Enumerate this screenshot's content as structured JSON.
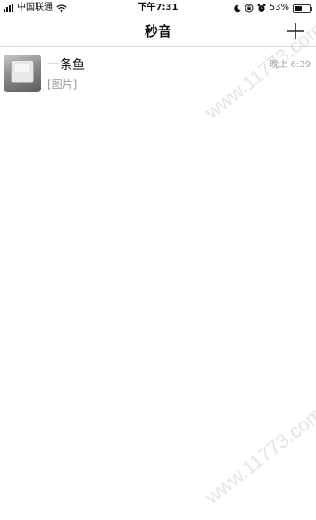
{
  "status_bar": {
    "carrier": "中国联通",
    "time": "下午7:31",
    "battery_percent": "53%",
    "battery_level": 0.53,
    "icons": [
      "signal-icon",
      "wifi-icon",
      "moon-icon",
      "lock-rotation-icon",
      "alarm-icon",
      "battery-icon"
    ]
  },
  "nav": {
    "title": "秒音",
    "add_icon": "plus-icon"
  },
  "chats": [
    {
      "name": "一条鱼",
      "preview": "[图片]",
      "time": "晚上 6:39",
      "avatar": "photo-avatar"
    }
  ],
  "watermark": {
    "text": "www.11773.com"
  }
}
